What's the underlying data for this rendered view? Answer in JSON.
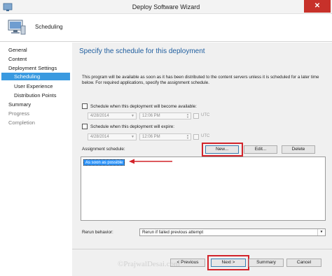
{
  "window": {
    "title": "Deploy Software Wizard",
    "close_glyph": "✕"
  },
  "header": {
    "title": "Scheduling"
  },
  "sidebar": {
    "items": [
      {
        "label": "General",
        "state": "normal"
      },
      {
        "label": "Content",
        "state": "normal"
      },
      {
        "label": "Deployment Settings",
        "state": "normal"
      },
      {
        "label": "Scheduling",
        "state": "selected"
      },
      {
        "label": "User Experience",
        "state": "normal"
      },
      {
        "label": "Distribution Points",
        "state": "normal"
      },
      {
        "label": "Summary",
        "state": "normal"
      },
      {
        "label": "Progress",
        "state": "dim"
      },
      {
        "label": "Completion",
        "state": "dim"
      }
    ]
  },
  "main": {
    "title": "Specify the schedule for this deployment",
    "description": "This program will be available as soon as it has been distributed to the content servers unless it is scheduled for a later time below. For required applications, specify the assignment schedule.",
    "available": {
      "label": "Schedule when this deployment will become available:",
      "date": "4/28/2014",
      "time": "12:06 PM",
      "utc_label": "UTC"
    },
    "expire": {
      "label": "Schedule when this deployment will expire:",
      "date": "4/28/2014",
      "time": "12:06 PM",
      "utc_label": "UTC"
    },
    "assignment": {
      "label": "Assignment schedule:",
      "new_label": "New...",
      "edit_label": "Edit...",
      "delete_label": "Delete",
      "items": [
        "As soon as possible"
      ]
    },
    "rerun": {
      "label": "Rerun behavior:",
      "value": "Rerun if failed previous attempt"
    }
  },
  "footer": {
    "previous_label": "< Previous",
    "next_label": "Next >",
    "summary_label": "Summary",
    "cancel_label": "Cancel"
  },
  "watermark": "©PrajwalDesai.com",
  "colors": {
    "accent": "#3a9ae0",
    "title_blue": "#1e5d9e",
    "annotation_red": "#d2232a",
    "selection": "#3399ff"
  }
}
